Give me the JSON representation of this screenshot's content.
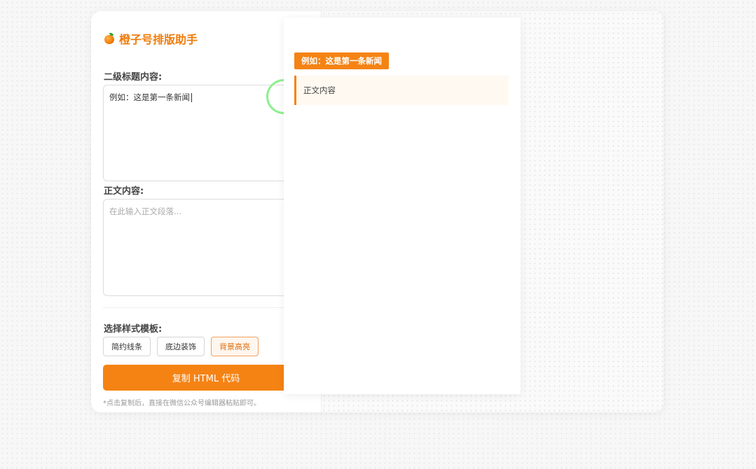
{
  "app": {
    "title": "橙子号排版助手",
    "icon": "orange-icon",
    "accent": "#f58314"
  },
  "editor": {
    "h2_label": "二级标题内容:",
    "h2_value": "例如：这是第一条新闻",
    "body_label": "正文内容:",
    "body_placeholder": "在此输入正文段落...",
    "template_label": "选择样式模板:",
    "templates": [
      "简约线条",
      "底边装饰",
      "背景高亮"
    ],
    "selected_template": "背景高亮",
    "copy_button": "复制 HTML 代码",
    "hint": "*点击复制后，直接在微信公众号编辑器粘贴即可。"
  },
  "preview": {
    "h2_text": "例如：这是第一条新闻",
    "body_text": "正文内容"
  }
}
